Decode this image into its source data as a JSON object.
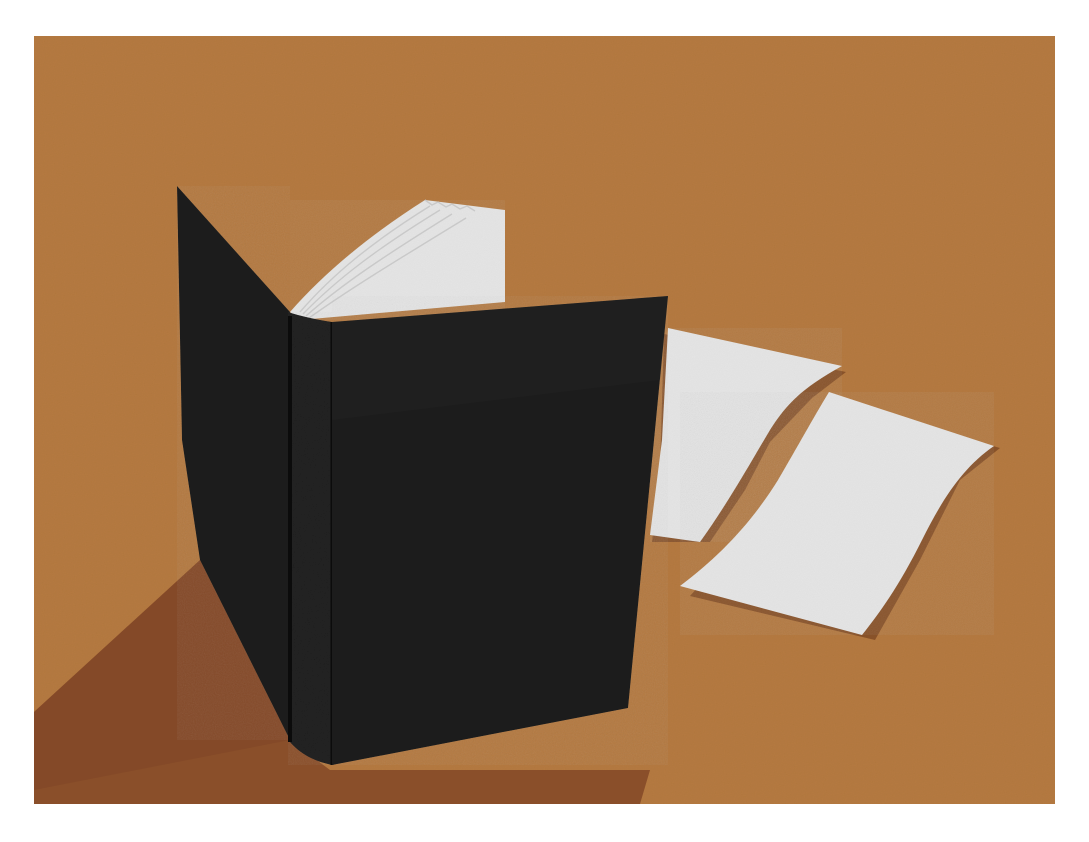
{
  "illustration": {
    "subject": "open-black-book-with-loose-pages",
    "colors": {
      "frame": "#ffffff",
      "table": "#b57a40",
      "table_shadow": "#8a4f2a",
      "book_cover": "#1d1d1d",
      "book_spine_line": "#0b0b0b",
      "pages": "#e6e6e6",
      "page_edge": "#c9c9c9",
      "page_shadow": "#7a4522"
    }
  }
}
